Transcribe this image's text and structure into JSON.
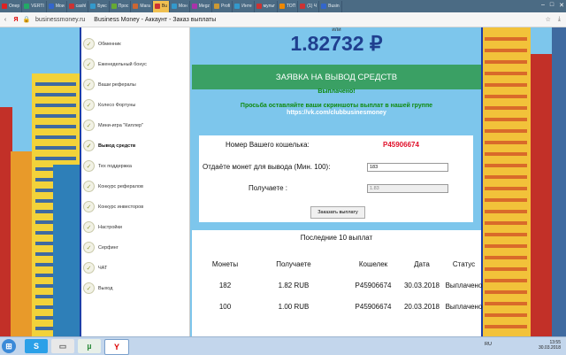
{
  "browser": {
    "tabs": [
      {
        "label": "Опер",
        "color": "#d22"
      },
      {
        "label": "VERTI",
        "color": "#2a6"
      },
      {
        "label": "Мои",
        "color": "#36c"
      },
      {
        "label": "cashl",
        "color": "#c33"
      },
      {
        "label": "Букс",
        "color": "#39c"
      },
      {
        "label": "Прос",
        "color": "#6a3"
      },
      {
        "label": "Мага",
        "color": "#c63"
      },
      {
        "label": "Bu",
        "color": "#c33"
      },
      {
        "label": "Мон",
        "color": "#39c"
      },
      {
        "label": "Megz",
        "color": "#a3a"
      },
      {
        "label": "Profi",
        "color": "#c93"
      },
      {
        "label": "Инте",
        "color": "#39c"
      },
      {
        "label": "мульт",
        "color": "#c33"
      },
      {
        "label": "ТОП",
        "color": "#e80"
      },
      {
        "label": "(1) Ч",
        "color": "#c33"
      },
      {
        "label": "Busin",
        "color": "#36c"
      }
    ],
    "url": "businessmoney.ru",
    "page_title": "Business Money - Аккаунт - Заказ выплаты"
  },
  "sidebar": {
    "items": [
      {
        "label": "Обменник"
      },
      {
        "label": "Еженедельный бонус"
      },
      {
        "label": "Ваши рефералы"
      },
      {
        "label": "Колесо Фортуны"
      },
      {
        "label": "Мини-игра \"Киллер\""
      },
      {
        "label": "Вывод средств"
      },
      {
        "label": "Тех поддержка"
      },
      {
        "label": "Конкурс рефералов"
      },
      {
        "label": "Конкурс инвесторов"
      },
      {
        "label": "Настройки"
      },
      {
        "label": "Серфинг"
      },
      {
        "label": "ЧАТ"
      },
      {
        "label": "Выход"
      }
    ]
  },
  "main": {
    "or_text": "или",
    "balance": "1.82732 ₽",
    "withdraw_button": "ЗАЯВКА НА ВЫВОД СРЕДСТВ",
    "status": "Выплачено!",
    "request_text": "Просьба оставляйте ваши скриншоты выплат в нашей группе",
    "vk_link": "https://vk.com/clubbusinesmoney",
    "form": {
      "wallet_label": "Номер Вашего кошелька:",
      "wallet_value": "P45906674",
      "amount_label": "Отдаёте монет для вывода (Мин. 100):",
      "amount_value": "183",
      "receive_label": "Получаете :",
      "receive_value": "1.83",
      "order_button": "Заказать выплату"
    },
    "payouts": {
      "title": "Последние 10 выплат",
      "headers": [
        "Монеты",
        "Получаете",
        "Кошелек",
        "Дата",
        "Статус"
      ],
      "rows": [
        [
          "182",
          "1.82 RUB",
          "P45906674",
          "30.03.2018",
          "Выплачено"
        ],
        [
          "100",
          "1.00 RUB",
          "P45906674",
          "20.03.2018",
          "Выплачено"
        ]
      ]
    }
  },
  "taskbar": {
    "lang": "RU",
    "time": "13:55",
    "date": "30.03.2018"
  }
}
